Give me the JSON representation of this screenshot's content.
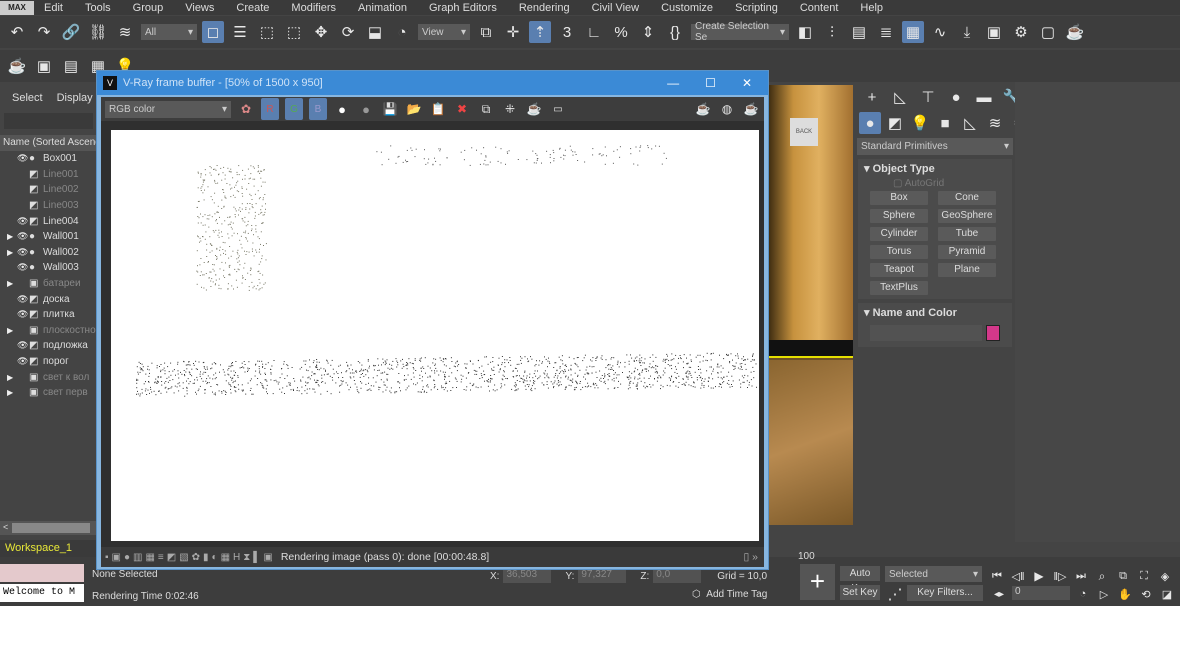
{
  "menu": {
    "logo": "MAX",
    "items": [
      "Edit",
      "Tools",
      "Group",
      "Views",
      "Create",
      "Modifiers",
      "Animation",
      "Graph Editors",
      "Rendering",
      "Civil View",
      "Customize",
      "Scripting",
      "Content",
      "Help"
    ]
  },
  "toolbar": {
    "filter": "All",
    "ref_coord": "View",
    "selection_set": "Create Selection Se"
  },
  "left": {
    "tabs": [
      "Select",
      "Display"
    ],
    "header": "Name (Sorted Ascending)",
    "items": [
      {
        "name": "Box001",
        "vis": true,
        "exp": false,
        "type": "sphere"
      },
      {
        "name": "Line001",
        "vis": false,
        "exp": false,
        "type": "shape"
      },
      {
        "name": "Line002",
        "vis": false,
        "exp": false,
        "type": "shape"
      },
      {
        "name": "Line003",
        "vis": false,
        "exp": false,
        "type": "shape"
      },
      {
        "name": "Line004",
        "vis": true,
        "exp": false,
        "type": "shape"
      },
      {
        "name": "Wall001",
        "vis": true,
        "exp": true,
        "type": "sphere"
      },
      {
        "name": "Wall002",
        "vis": true,
        "exp": true,
        "type": "sphere"
      },
      {
        "name": "Wall003",
        "vis": true,
        "exp": false,
        "type": "sphere"
      },
      {
        "name": "батареи",
        "vis": false,
        "exp": true,
        "type": "group"
      },
      {
        "name": "доска",
        "vis": true,
        "exp": false,
        "type": "shape"
      },
      {
        "name": "плитка",
        "vis": true,
        "exp": false,
        "type": "shape"
      },
      {
        "name": "плоскостно",
        "vis": false,
        "exp": true,
        "type": "group"
      },
      {
        "name": "подложка",
        "vis": true,
        "exp": false,
        "type": "shape"
      },
      {
        "name": "порог",
        "vis": true,
        "exp": false,
        "type": "shape"
      },
      {
        "name": "свет к вол",
        "vis": false,
        "exp": true,
        "type": "group"
      },
      {
        "name": "свет перв",
        "vis": false,
        "exp": true,
        "type": "group"
      }
    ],
    "workspace": "Workspace_1",
    "listener": "Welcome to M"
  },
  "vfb": {
    "title": "V-Ray frame buffer - [50% of 1500 x 950]",
    "channel": "RGB color",
    "r": "R",
    "g": "G",
    "b": "B",
    "status": "Rendering image (pass 0): done [00:00:48.8]"
  },
  "cmd": {
    "category": "Standard Primitives",
    "object_type": "Object Type",
    "autogrid": "AutoGrid",
    "buttons": [
      "Box",
      "Cone",
      "Sphere",
      "GeoSphere",
      "Cylinder",
      "Tube",
      "Torus",
      "Pyramid",
      "Teapot",
      "Plane",
      "TextPlus"
    ],
    "name_color": "Name and Color",
    "color": "#d3388a"
  },
  "status": {
    "selected": "None Selected",
    "render_time": "Rendering Time  0:02:46",
    "x_label": "X:",
    "x": "36,503",
    "y_label": "Y:",
    "y": "97,327",
    "z_label": "Z:",
    "z": "0,0",
    "grid": "Grid = 10,0",
    "add_time_tag": "Add Time Tag",
    "frame_end": "100",
    "auto_key": "Auto Key",
    "set_key": "Set Key",
    "key_mode": "Selected",
    "key_filters": "Key Filters...",
    "frame": "0"
  }
}
